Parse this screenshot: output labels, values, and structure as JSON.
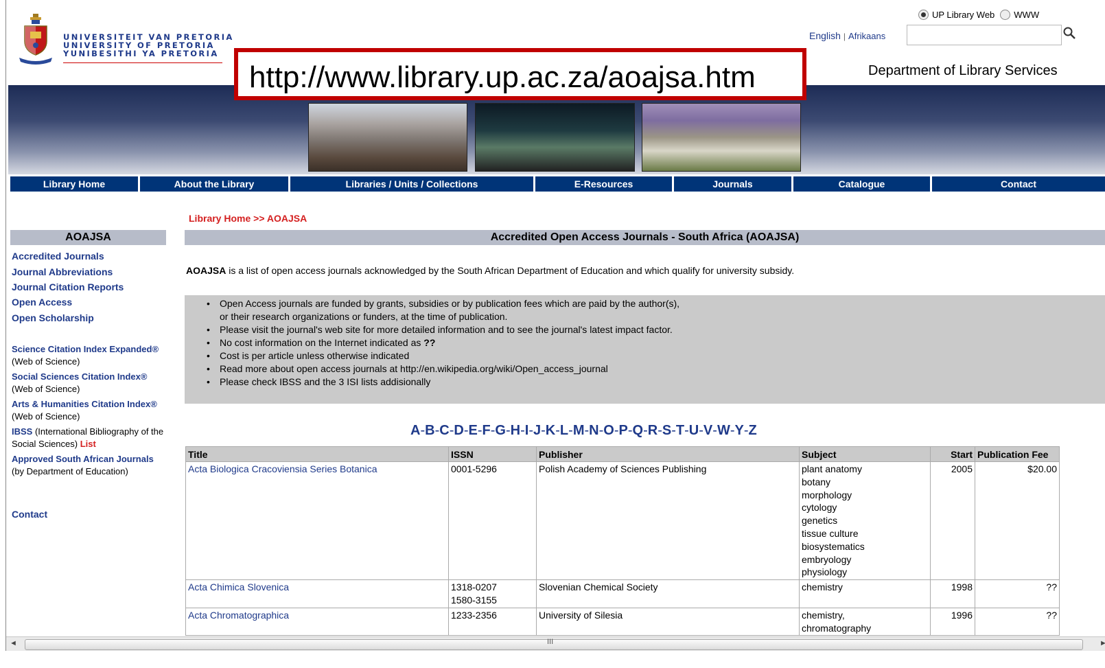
{
  "header": {
    "university_lines": [
      "UNIVERSITEIT VAN PRETORIA",
      "UNIVERSITY OF PRETORIA",
      "YUNIBESITHI YA PRETORIA"
    ],
    "search_scope": [
      "UP Library Web",
      "WWW"
    ],
    "languages": [
      "English",
      "Afrikaans"
    ],
    "department": "Department of Library Services",
    "url_callout": "http://www.library.up.ac.za/aoajsa.htm"
  },
  "nav": [
    "Library Home",
    "About the Library",
    "Libraries / Units / Collections",
    "E-Resources",
    "Journals",
    "Catalogue",
    "Contact"
  ],
  "breadcrumb": "Library Home >> AOAJSA",
  "sidebar": {
    "heading": "AOAJSA",
    "links": [
      "Accredited Journals",
      "Journal Abbreviations",
      "Journal Citation Reports",
      "Open Access",
      "Open Scholarship"
    ],
    "sci_link": "Science Citation Index Expanded®",
    "sci_note": " (Web of Science)",
    "ssci_link": "Social Sciences Citation Index®",
    "ssci_note": "(Web of Science)",
    "ahci_link": "Arts & Humanities Citation Index®",
    "ahci_note": " (Web of Science)",
    "ibss_link": "IBSS",
    "ibss_note": " (International Bibliography of the Social Sciences) ",
    "ibss_list": "List",
    "approved_link": "Approved South African Journals",
    "approved_note": " (by Department of Education)",
    "contact": "Contact"
  },
  "main": {
    "heading": "Accredited Open Access Journals - South Africa (AOAJSA)",
    "intro_bold": "AOAJSA",
    "intro_rest": " is a list of open access journals acknowledged by the South African Department of Education and which qualify for university subsidy.",
    "notes": [
      "Open Access journals are funded by grants, subsidies or by publication fees which are paid by the author(s),",
      "or their research organizations or funders, at the time of publication.",
      "Please visit the journal's web site for more detailed information and to see the journal's latest impact factor.",
      "No cost information on the Internet indicated as ",
      "Cost is per article unless otherwise indicated",
      "Read more about open access journals at http://en.wikipedia.org/wiki/Open_access_journal",
      "Please check IBSS and the 3 ISI lists addisionally"
    ],
    "notes_qq": "??",
    "alphabet": [
      "A",
      "B",
      "C",
      "D",
      "E",
      "F",
      "G",
      "H",
      "I",
      "J",
      "K",
      "L",
      "M",
      "N",
      "O",
      "P",
      "Q",
      "R",
      "S",
      "T",
      "U",
      "V",
      "W",
      "Y",
      "Z"
    ]
  },
  "table": {
    "headers": [
      "Title",
      "ISSN",
      "Publisher",
      "Subject",
      "Start",
      "Publication Fee"
    ],
    "rows": [
      {
        "title": "Acta Biologica Cracoviensia Series Botanica",
        "issn": [
          "0001-5296"
        ],
        "publisher": "Polish Academy of Sciences Publishing",
        "subject": [
          "plant anatomy",
          "botany",
          "morphology",
          "cytology",
          "genetics",
          "tissue culture",
          "biosystematics",
          "embryology",
          "physiology"
        ],
        "start": "2005",
        "fee": "$20.00"
      },
      {
        "title": "Acta Chimica Slovenica",
        "issn": [
          "1318-0207",
          "1580-3155"
        ],
        "publisher": "Slovenian Chemical Society",
        "subject": [
          "chemistry"
        ],
        "start": "1998",
        "fee": "??"
      },
      {
        "title": "Acta Chromatographica",
        "issn": [
          "1233-2356"
        ],
        "publisher": "University of Silesia",
        "subject": [
          "chemistry,",
          "chromatography"
        ],
        "start": "1996",
        "fee": "??"
      }
    ]
  },
  "scrollbar": {
    "grip": "III",
    "left_arrow": "◄",
    "right_arrow": "►"
  }
}
